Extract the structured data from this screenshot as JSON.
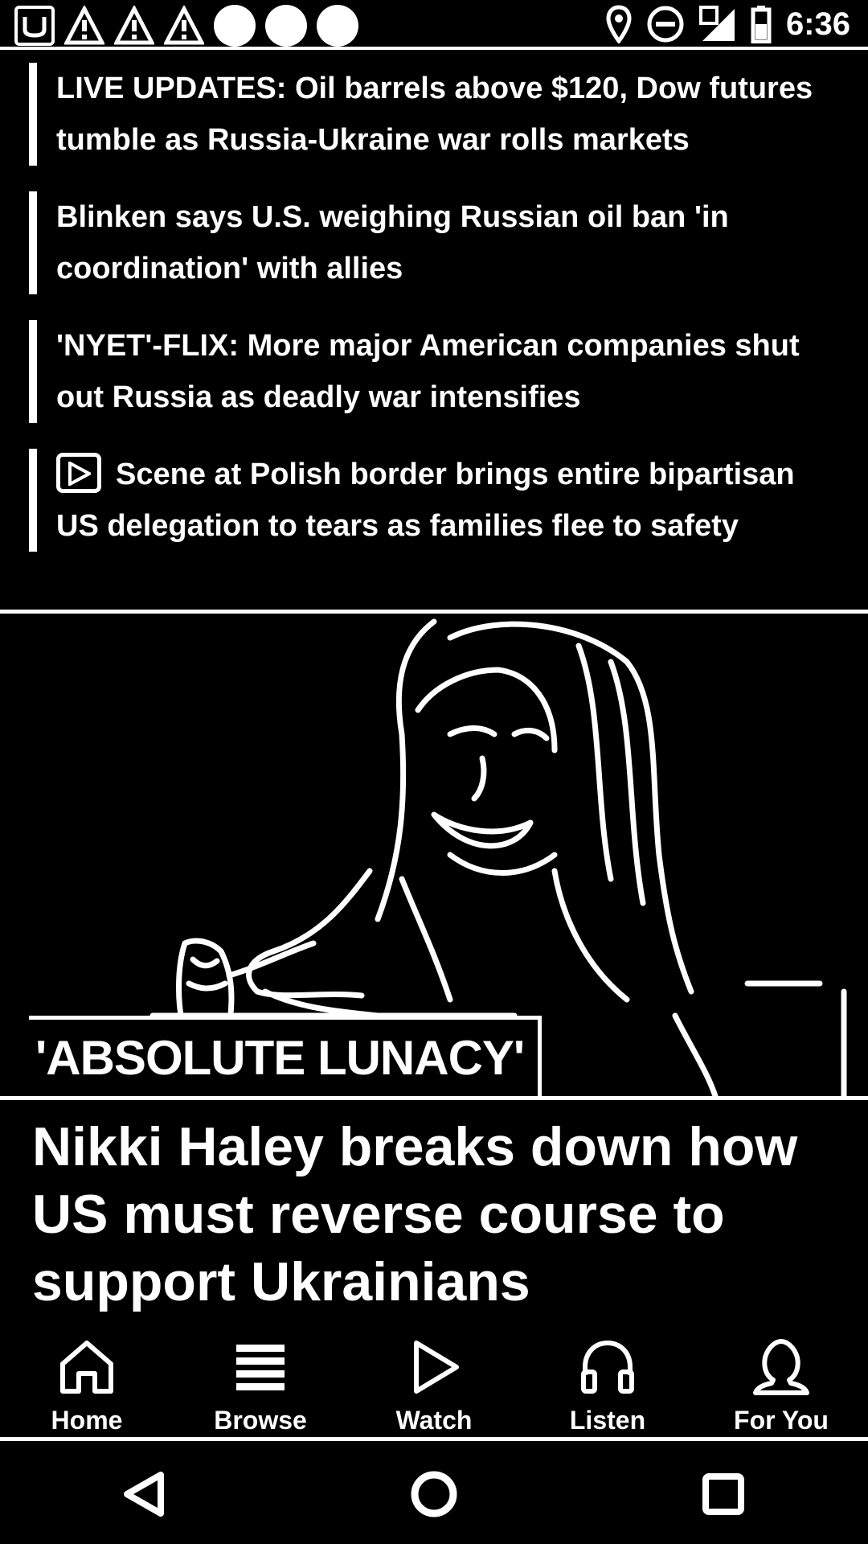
{
  "status_bar": {
    "time": "6:36",
    "left_icons": [
      "app-notification-icon",
      "warning-icon",
      "warning-icon",
      "warning-icon",
      "notification-dot",
      "notification-dot",
      "notification-dot"
    ],
    "right_icons": [
      "location-icon",
      "do-not-disturb-icon",
      "signal-icon",
      "battery-icon"
    ]
  },
  "headlines": [
    {
      "text": "LIVE UPDATES: Oil barrels above $120, Dow futures tumble as Russia-Ukraine war rolls markets",
      "has_video": false
    },
    {
      "text": "Blinken says U.S. weighing Russian oil ban 'in coordination' with allies",
      "has_video": false
    },
    {
      "text": "'NYET'-FLIX: More major American companies shut out Russia as deadly war intensifies",
      "has_video": false
    },
    {
      "text": "Scene at Polish border brings entire bipartisan US delegation to tears as families flee to safety",
      "has_video": true
    }
  ],
  "hero": {
    "badge": "'ABSOLUTE LUNACY'",
    "title": "Nikki Haley breaks down how US must reverse course to support Ukrainians"
  },
  "bottom_nav": {
    "items": [
      {
        "label": "Home",
        "icon": "home-icon"
      },
      {
        "label": "Browse",
        "icon": "browse-icon"
      },
      {
        "label": "Watch",
        "icon": "play-icon"
      },
      {
        "label": "Listen",
        "icon": "headphones-icon"
      },
      {
        "label": "For You",
        "icon": "person-icon"
      }
    ]
  },
  "system_nav": [
    "back-icon",
    "home-circle-icon",
    "recents-icon"
  ]
}
